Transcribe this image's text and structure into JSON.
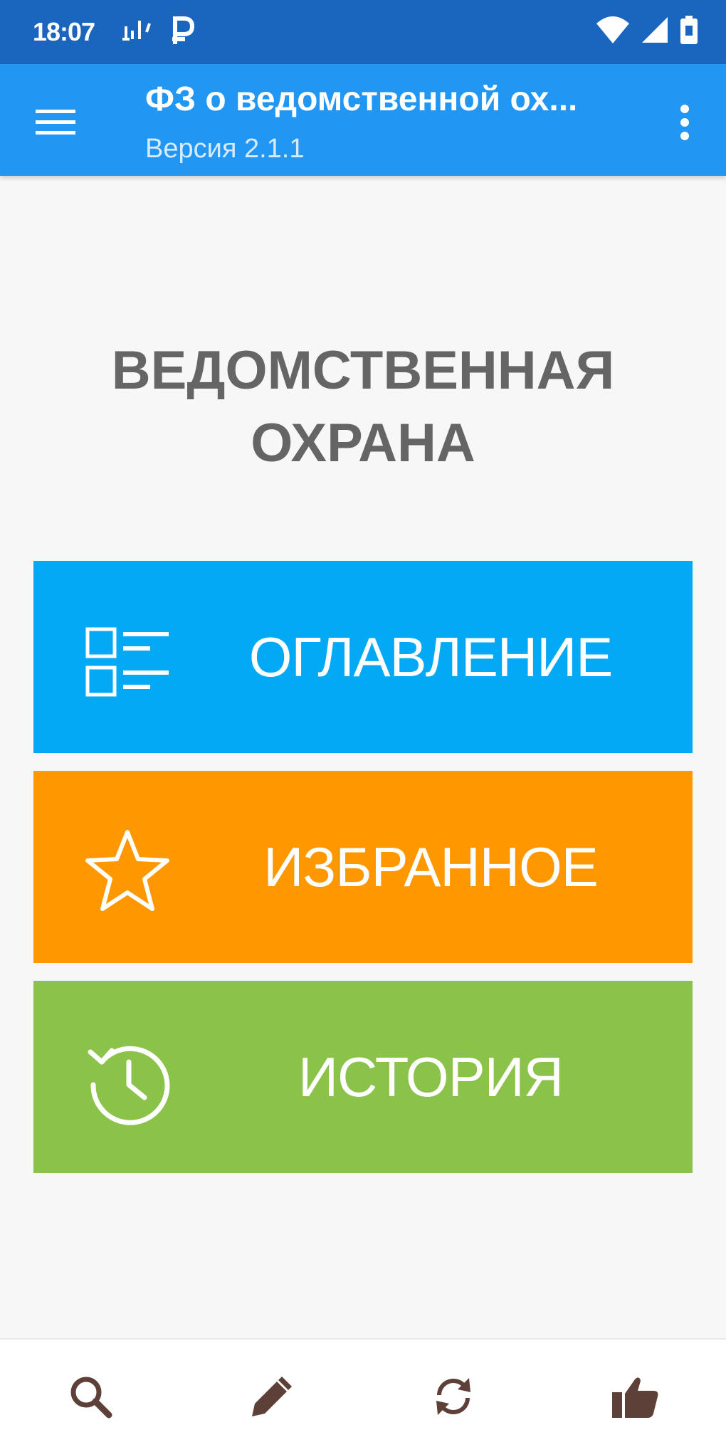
{
  "status_bar": {
    "time": "18:07",
    "icons": [
      "signal-icon",
      "p-badge-icon",
      "wifi-icon",
      "cellular-icon",
      "battery-icon"
    ]
  },
  "app_bar": {
    "title": "ФЗ о ведомственной ох...",
    "subtitle": "Версия 2.1.1",
    "icons": [
      "menu-icon",
      "more-vert-icon"
    ]
  },
  "heading": {
    "line1": "ВЕДОМСТВЕННАЯ",
    "line2": "ОХРАНА"
  },
  "tiles": [
    {
      "label": "ОГЛАВЛЕНИЕ",
      "icon": "list-icon",
      "color": "#03a9f4"
    },
    {
      "label": "ИЗБРАННОЕ",
      "icon": "star-icon",
      "color": "#ff9800"
    },
    {
      "label": "ИСТОРИЯ",
      "icon": "history-icon",
      "color": "#8bc34a"
    }
  ],
  "bottom_bar": {
    "icons": [
      "search-icon",
      "pencil-icon",
      "refresh-icon",
      "thumbs-up-icon"
    ],
    "icon_color": "#5d4037"
  },
  "colors": {
    "status_bar": "#1a66be",
    "app_bar": "#2196f3",
    "heading": "#656565",
    "background": "#f7f7f7"
  }
}
